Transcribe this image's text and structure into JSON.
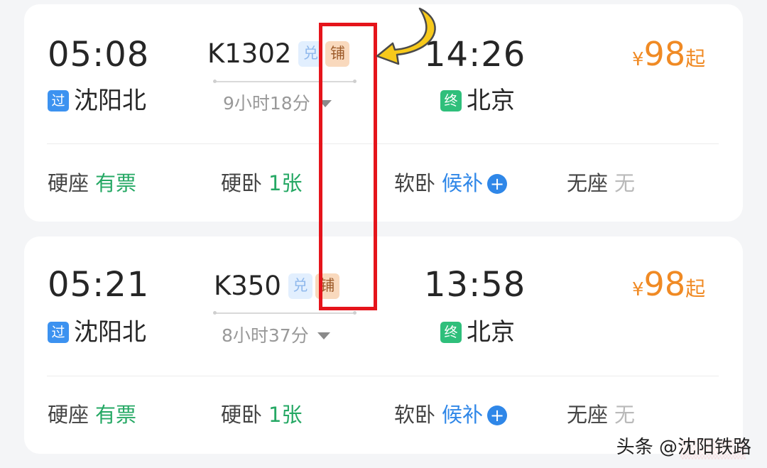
{
  "trains": [
    {
      "depart_time": "05:08",
      "depart_badge": "过",
      "depart_station": "沈阳北",
      "train_no": "K1302",
      "tag_dui": "兑",
      "tag_pu": "铺",
      "duration": "9小时18分",
      "arrive_time": "14:26",
      "arrive_badge": "终",
      "arrive_station": "北京",
      "price_symbol": "¥",
      "price": "98",
      "price_suffix": "起",
      "seats": [
        {
          "type": "硬座",
          "status": "有票"
        },
        {
          "type": "硬卧",
          "status": "1张"
        },
        {
          "type": "软卧",
          "status": "候补"
        },
        {
          "type": "无座",
          "status": "无"
        }
      ]
    },
    {
      "depart_time": "05:21",
      "depart_badge": "过",
      "depart_station": "沈阳北",
      "train_no": "K350",
      "tag_dui": "兑",
      "tag_pu": "铺",
      "duration": "8小时37分",
      "arrive_time": "13:58",
      "arrive_badge": "终",
      "arrive_station": "北京",
      "price_symbol": "¥",
      "price": "98",
      "price_suffix": "起",
      "seats": [
        {
          "type": "硬座",
          "status": "有票"
        },
        {
          "type": "硬卧",
          "status": "1张"
        },
        {
          "type": "软卧",
          "status": "候补"
        },
        {
          "type": "无座",
          "status": "无"
        }
      ]
    }
  ],
  "watermark": "头条 @沈阳铁路",
  "colors": {
    "price": "#f08a24",
    "available": "#25a864",
    "waitlist": "#2f87e8",
    "none": "#b9b9b9",
    "highlight": "#e5141b",
    "arrow": "#f7c91b"
  }
}
